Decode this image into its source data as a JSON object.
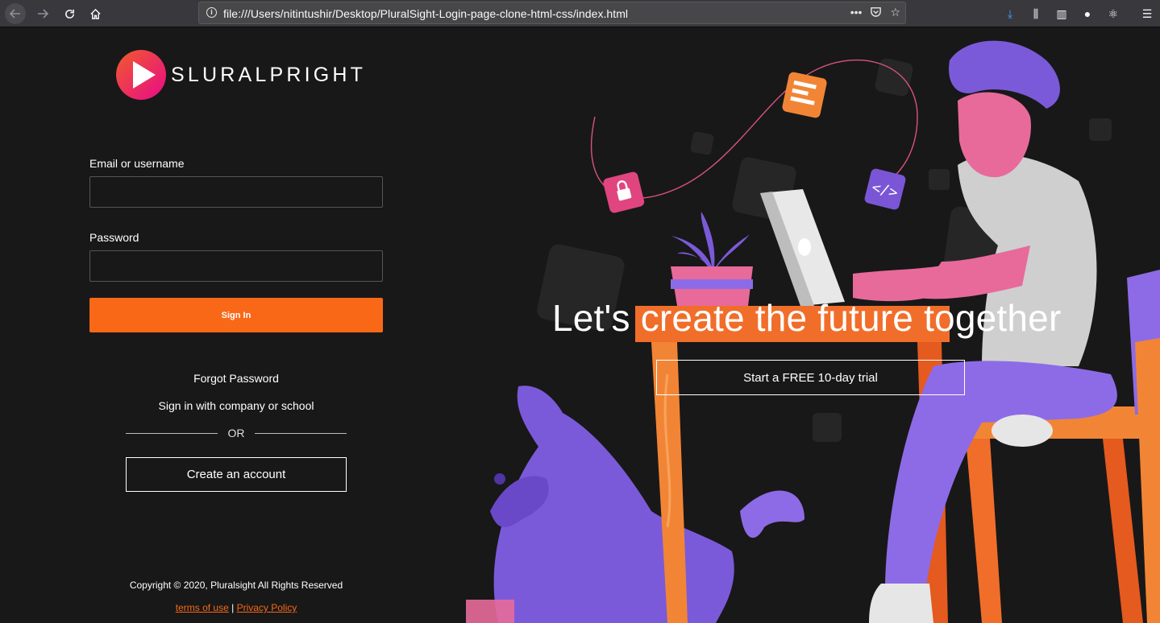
{
  "browser": {
    "url": "file:///Users/nitintushir/Desktop/PluralSight-Login-page-clone-html-css/index.html",
    "url_actions": [
      "more-icon",
      "pocket-icon",
      "bookmark-star-icon"
    ],
    "toolbar_icons": [
      "download-icon",
      "library-icon",
      "sidebar-icon",
      "account-icon",
      "react-devtools-icon",
      "menu-icon"
    ]
  },
  "brand": {
    "name": "SLURALPRIGHT",
    "accent": "#f96817"
  },
  "login": {
    "email_label": "Email or username",
    "email_value": "",
    "password_label": "Password",
    "password_value": "",
    "signin_label": "Sign In",
    "forgot_label": "Forgot Password",
    "company_label": "Sign in with company or school",
    "or_label": "OR",
    "create_label": "Create an account"
  },
  "footer": {
    "copyright": "Copyright © 2020, Pluralsight All Rights Reserved",
    "terms_label": "terms of use",
    "separator": "|",
    "privacy_label": "Privacy Policy"
  },
  "hero": {
    "title": "Let's create the future together",
    "trial_label": "Start a FREE 10-day trial"
  }
}
